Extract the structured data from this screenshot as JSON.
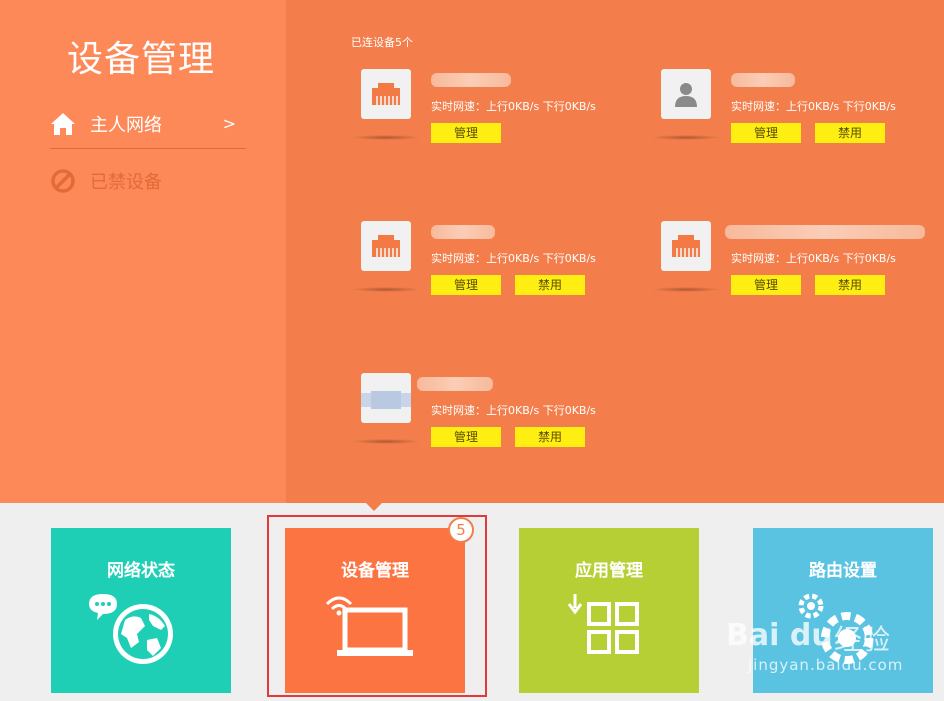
{
  "sidebar": {
    "title": "设备管理",
    "items": [
      {
        "label": "主人网络",
        "chevron": ">"
      },
      {
        "label": "已禁设备"
      }
    ]
  },
  "main": {
    "connected_label": "已连设备5个",
    "devices": [
      {
        "icon": "ethernet-icon",
        "speed": "实时网速：上行0KB/s  下行0KB/s",
        "manage": "管理",
        "ban": null
      },
      {
        "icon": "user-icon",
        "speed": "实时网速：上行0KB/s  下行0KB/s",
        "manage": "管理",
        "ban": "禁用"
      },
      {
        "icon": "ethernet-icon",
        "speed": "实时网速：上行0KB/s  下行0KB/s",
        "manage": "管理",
        "ban": "禁用"
      },
      {
        "icon": "ethernet-icon",
        "speed": "实时网速：上行0KB/s  下行0KB/s",
        "manage": "管理",
        "ban": "禁用"
      },
      {
        "icon": "device-icon",
        "speed": "实时网速：上行0KB/s  下行0KB/s",
        "manage": "管理",
        "ban": "禁用"
      }
    ]
  },
  "tiles": [
    {
      "label": "网络状态",
      "color": "#1fcfb5",
      "icon": "globe-icon"
    },
    {
      "label": "设备管理",
      "color": "#fd7443",
      "icon": "laptop-wifi-icon"
    },
    {
      "label": "应用管理",
      "color": "#b5cf34",
      "icon": "apps-grid-icon"
    },
    {
      "label": "路由设置",
      "color": "#59c3e1",
      "icon": "gears-icon"
    }
  ],
  "annotation": {
    "badge": "5"
  },
  "watermark": {
    "brand": "Bai du",
    "brand_cn": "经验",
    "url": "jingyan.baidu.com"
  }
}
